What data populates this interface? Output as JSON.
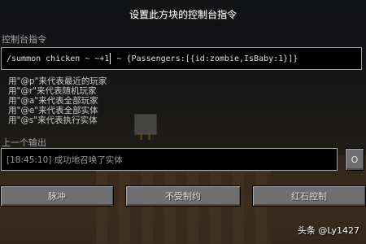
{
  "title": "设置此方块的控制台指令",
  "command_label": "控制台指令",
  "command": {
    "before_cursor": "/summon chicken ~ ~+1",
    "after_cursor": " ~ {Passengers:[{id:zombie,IsBaby:1}]}"
  },
  "hints": [
    "用\"@p\"来代表最近的玩家",
    "用\"@r\"来代表随机玩家",
    "用\"@a\"来代表全部玩家",
    "用\"@e\"来代表全部实体",
    "用\"@s\"来代表执行实体"
  ],
  "output_label": "上一个输出",
  "output_text": "[18:45:10] 成功地召唤了实体",
  "output_toggle": "O",
  "buttons": {
    "mode": "脉冲",
    "conditional": "不受制约",
    "redstone": "红石控制"
  },
  "watermark": "头条 @Ly1427"
}
